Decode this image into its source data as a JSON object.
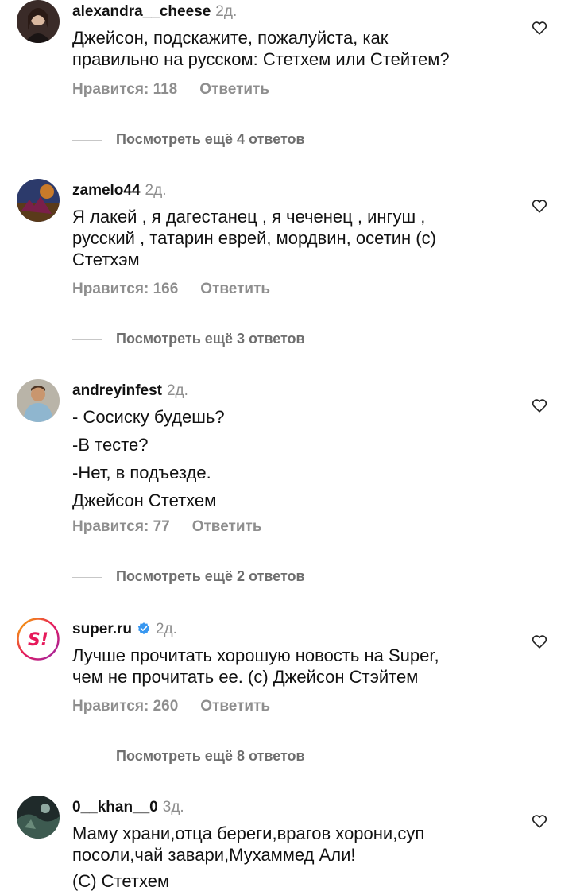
{
  "comments": [
    {
      "username": "alexandra__cheese",
      "time": "2д.",
      "lines": [
        "Джейсон, подскажите, пожалуйста, как",
        "правильно на русском: Стетхем или Стейтем?"
      ],
      "likes": "Нравится: 118",
      "reply": "Ответить",
      "more": "Посмотреть ещё 4 ответов"
    },
    {
      "username": "zamelo44",
      "time": "2д.",
      "lines": [
        "Я лакей , я дагестанец , я чеченец , ингуш ,",
        "русский , татарин еврей, мордвин, осетин (с)",
        "Стетхэм"
      ],
      "likes": "Нравится: 166",
      "reply": "Ответить",
      "more": "Посмотреть ещё 3 ответов"
    },
    {
      "username": "andreyinfest",
      "time": "2д.",
      "lines": [
        "- Сосиску будешь?",
        "-В тесте?",
        "-Нет, в подъезде.",
        "Джейсон Стетхем"
      ],
      "likes": "Нравится: 77",
      "reply": "Ответить",
      "more": "Посмотреть ещё 2 ответов"
    },
    {
      "username": "super.ru",
      "time": "2д.",
      "verified": true,
      "avatar_text": "S!",
      "lines": [
        "Лучше прочитать хорошую новость на Super,",
        "чем не прочитать ее. (с) Джейсон Стэйтем"
      ],
      "likes": "Нравится: 260",
      "reply": "Ответить",
      "more": "Посмотреть ещё 8 ответов"
    },
    {
      "username": "0__khan__0",
      "time": "3д.",
      "lines": [
        "Маму храни,отца береги,врагов хорони,суп",
        "посоли,чай завари,Мухаммед Али!",
        "(С) Стетхем"
      ]
    }
  ],
  "colors": {
    "text": "#111111",
    "muted": "#8e8e8e",
    "verified": "#3897f0",
    "super_brand": "#e6195a"
  },
  "icons": [
    "heart-icon",
    "verified-badge-icon"
  ]
}
